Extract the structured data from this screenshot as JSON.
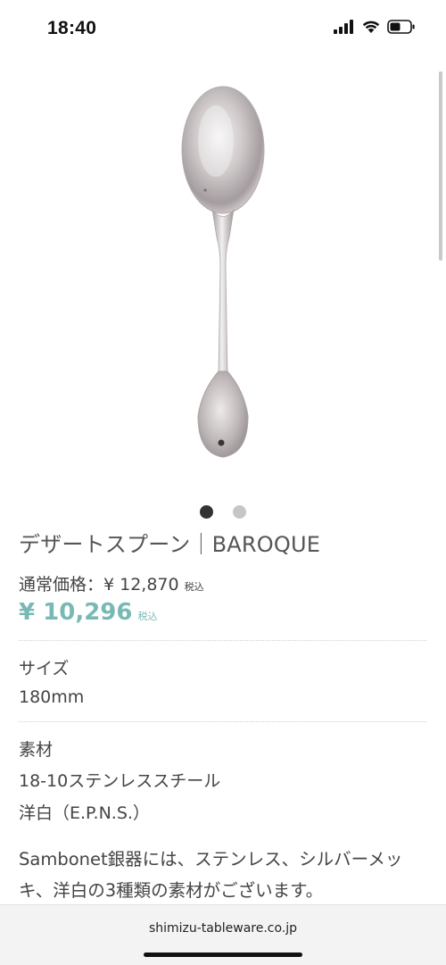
{
  "status_bar": {
    "time": "18:40",
    "icons": [
      "cellular-signal-icon",
      "wifi-icon",
      "battery-icon"
    ]
  },
  "product": {
    "image_alt": "spoon",
    "carousel": {
      "count": 2,
      "active_index": 0
    },
    "title": "デザートスプーン｜BAROQUE",
    "regular_price_label": "通常価格：¥ 12,870",
    "regular_price_tax": "税込",
    "sale_price": "¥ 10,296",
    "sale_price_tax": "税込"
  },
  "specs": {
    "size_label": "サイズ",
    "size_value": "180mm",
    "material_label": "素材",
    "material_values": [
      "18-10ステンレススチール",
      "洋白（E.P.N.S.）"
    ]
  },
  "description": {
    "lines": [
      "Sambonet銀器には、ステンレス、シルバーメッ",
      "キ、洋白の3種類の素材がございます。"
    ]
  },
  "browser": {
    "url": "shimizu-tableware.co.jp"
  },
  "colors": {
    "sale_accent": "#79b9b5",
    "text": "#444444",
    "dot_active": "#333333",
    "dot_inactive": "#c6c6c6"
  }
}
